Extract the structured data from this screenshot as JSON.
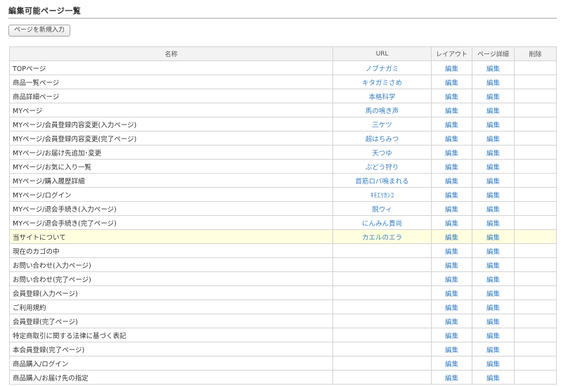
{
  "page": {
    "title": "編集可能ページ一覧",
    "new_button_label": "ページを新規入力"
  },
  "table": {
    "headers": [
      "名称",
      "URL",
      "レイアウト",
      "ページ詳細",
      "削除"
    ],
    "rows": [
      {
        "name": "TOPページ",
        "url": "ノブナガミ",
        "layout": "編集",
        "detail": "編集",
        "delete": ""
      },
      {
        "name": "商品一覧ページ",
        "url": "キタガミさめ",
        "layout": "編集",
        "detail": "編集",
        "delete": ""
      },
      {
        "name": "商品詳細ページ",
        "url": "本格科学",
        "layout": "編集",
        "detail": "編集",
        "delete": ""
      },
      {
        "name": "MYページ",
        "url": "馬の鳴き声",
        "layout": "編集",
        "detail": "編集",
        "delete": ""
      },
      {
        "name": "MYページ/会員登録内容変更(入力ページ)",
        "url": "三ケツ",
        "layout": "編集",
        "detail": "編集",
        "delete": ""
      },
      {
        "name": "MYページ/会員登録内容変更(完了ページ)",
        "url": "超はちみつ",
        "layout": "編集",
        "detail": "編集",
        "delete": ""
      },
      {
        "name": "MYページ/お届け先追加･変更",
        "url": "天つゆ",
        "layout": "編集",
        "detail": "編集",
        "delete": ""
      },
      {
        "name": "MYページ/お気に入り一覧",
        "url": "ぶどう狩り",
        "layout": "編集",
        "detail": "編集",
        "delete": ""
      },
      {
        "name": "MYページ/購入履歴詳細",
        "url": "首筋ロバ鳴まれる",
        "layout": "編集",
        "detail": "編集",
        "delete": ""
      },
      {
        "name": "MYページ/ログイン",
        "url": "ｷﾓｴﾘｶﾝｺ",
        "layout": "編集",
        "detail": "編集",
        "delete": ""
      },
      {
        "name": "MYページ/退会手続き(入力ページ)",
        "url": "脱ウィ",
        "layout": "編集",
        "detail": "編集",
        "delete": ""
      },
      {
        "name": "MYページ/退会手続き(完了ページ)",
        "url": "にんみん貴尚",
        "layout": "編集",
        "detail": "編集",
        "delete": ""
      },
      {
        "name": "当サイトについて",
        "url": "カエルのエラ",
        "layout": "編集",
        "detail": "編集",
        "delete": "",
        "highlight": true
      },
      {
        "name": "現在のカゴの中",
        "url": "",
        "layout": "編集",
        "detail": "編集",
        "delete": ""
      },
      {
        "name": "お問い合わせ(入力ページ)",
        "url": "",
        "layout": "編集",
        "detail": "編集",
        "delete": ""
      },
      {
        "name": "お問い合わせ(完了ページ)",
        "url": "",
        "layout": "編集",
        "detail": "編集",
        "delete": ""
      },
      {
        "name": "会員登録(入力ページ)",
        "url": "",
        "layout": "編集",
        "detail": "編集",
        "delete": ""
      },
      {
        "name": "ご利用規約",
        "url": "",
        "layout": "編集",
        "detail": "編集",
        "delete": ""
      },
      {
        "name": "会員登録(完了ページ)",
        "url": "",
        "layout": "編集",
        "detail": "編集",
        "delete": ""
      },
      {
        "name": "特定商取引に関する法律に基づく表記",
        "url": "",
        "layout": "編集",
        "detail": "編集",
        "delete": ""
      },
      {
        "name": "本会員登録(完了ページ)",
        "url": "",
        "layout": "編集",
        "detail": "編集",
        "delete": ""
      },
      {
        "name": "商品購入/ログイン",
        "url": "",
        "layout": "編集",
        "detail": "編集",
        "delete": ""
      },
      {
        "name": "商品購入/お届け先の指定",
        "url": "",
        "layout": "編集",
        "detail": "編集",
        "delete": ""
      }
    ]
  }
}
